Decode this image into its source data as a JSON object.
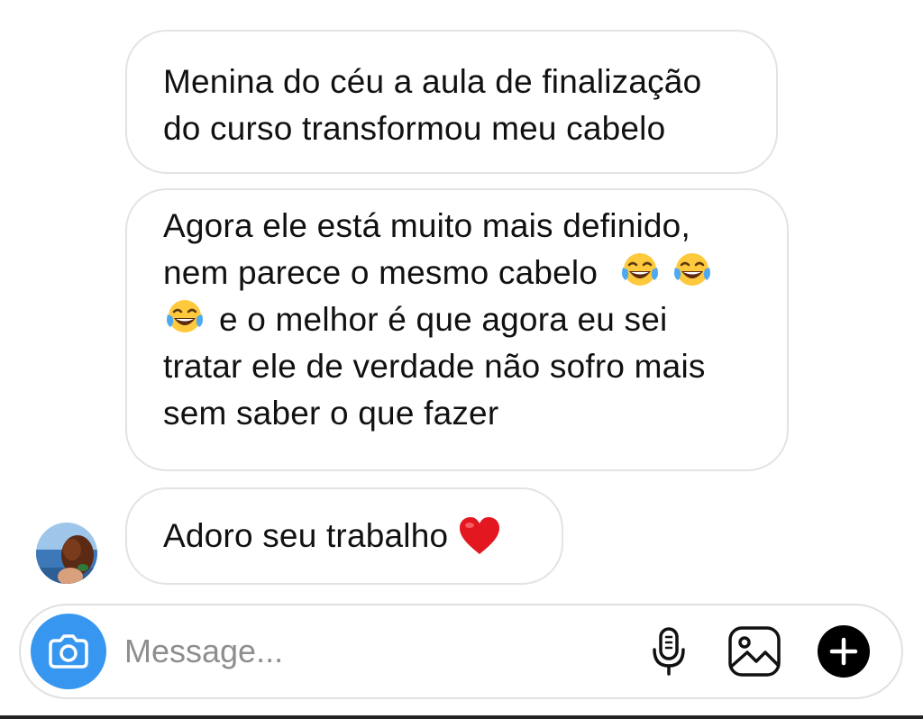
{
  "messages": [
    {
      "id": "m1",
      "lines": [
        "Menina do céu a aula de finalização",
        "do curso transformou meu cabelo"
      ]
    },
    {
      "id": "m2",
      "lines": [
        "Agora ele está muito mais definido,",
        "nem parece o mesmo cabelo",
        "e o melhor é que agora eu sei",
        "tratar ele de verdade não sofro mais",
        "sem saber o que fazer"
      ],
      "emojis": [
        "face-with-tears-of-joy",
        "face-with-tears-of-joy",
        "face-with-tears-of-joy"
      ]
    },
    {
      "id": "m3",
      "lines": [
        "Adoro seu trabalho"
      ],
      "emojis": [
        "red-heart"
      ]
    }
  ],
  "composer": {
    "placeholder": "Message...",
    "icons": [
      "camera-icon",
      "microphone-icon",
      "gallery-icon",
      "plus-icon"
    ],
    "accent_color": "#3797f0"
  }
}
